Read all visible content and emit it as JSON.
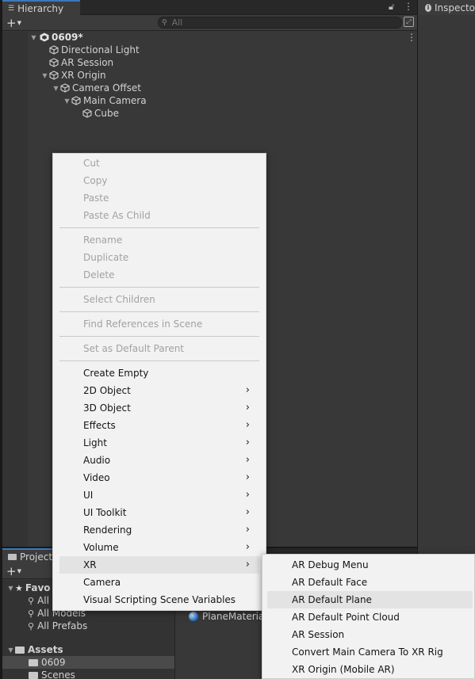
{
  "hierarchy": {
    "tab_label": "Hierarchy",
    "search_placeholder": "All",
    "scene_name": "0609*",
    "items": [
      {
        "label": "Directional Light"
      },
      {
        "label": "AR Session"
      },
      {
        "label": "XR Origin",
        "expanded": true
      },
      {
        "label": "Camera Offset",
        "expanded": true
      },
      {
        "label": "Main Camera",
        "expanded": true
      },
      {
        "label": "Cube"
      }
    ]
  },
  "inspector": {
    "tab_label": "Inspecto"
  },
  "project": {
    "tab_label": "Project",
    "favorites_label": "Favo",
    "favorite_items": [
      "All",
      "All Models",
      "All Prefabs"
    ],
    "assets_label": "Assets",
    "asset_folders": [
      "0609",
      "Scenes"
    ],
    "selected_folder": "0609",
    "content_item": "PlaneMateria"
  },
  "context_menu": {
    "groups": [
      [
        {
          "label": "Cut",
          "enabled": false
        },
        {
          "label": "Copy",
          "enabled": false
        },
        {
          "label": "Paste",
          "enabled": false
        },
        {
          "label": "Paste As Child",
          "enabled": false
        }
      ],
      [
        {
          "label": "Rename",
          "enabled": false
        },
        {
          "label": "Duplicate",
          "enabled": false
        },
        {
          "label": "Delete",
          "enabled": false
        }
      ],
      [
        {
          "label": "Select Children",
          "enabled": false
        }
      ],
      [
        {
          "label": "Find References in Scene",
          "enabled": false
        }
      ],
      [
        {
          "label": "Set as Default Parent",
          "enabled": false
        }
      ],
      [
        {
          "label": "Create Empty",
          "enabled": true
        },
        {
          "label": "2D Object",
          "enabled": true,
          "submenu": true
        },
        {
          "label": "3D Object",
          "enabled": true,
          "submenu": true
        },
        {
          "label": "Effects",
          "enabled": true,
          "submenu": true
        },
        {
          "label": "Light",
          "enabled": true,
          "submenu": true
        },
        {
          "label": "Audio",
          "enabled": true,
          "submenu": true
        },
        {
          "label": "Video",
          "enabled": true,
          "submenu": true
        },
        {
          "label": "UI",
          "enabled": true,
          "submenu": true
        },
        {
          "label": "UI Toolkit",
          "enabled": true,
          "submenu": true
        },
        {
          "label": "Rendering",
          "enabled": true,
          "submenu": true
        },
        {
          "label": "Volume",
          "enabled": true,
          "submenu": true
        },
        {
          "label": "XR",
          "enabled": true,
          "submenu": true,
          "highlighted": true
        },
        {
          "label": "Camera",
          "enabled": true
        },
        {
          "label": "Visual Scripting Scene Variables",
          "enabled": true
        }
      ]
    ]
  },
  "xr_submenu": {
    "items": [
      {
        "label": "AR Debug Menu"
      },
      {
        "label": "AR Default Face"
      },
      {
        "label": "AR Default Plane",
        "highlighted": true
      },
      {
        "label": "AR Default Point Cloud"
      },
      {
        "label": "AR Session"
      },
      {
        "label": "Convert Main Camera To XR Rig"
      },
      {
        "label": "XR Origin (Mobile AR)"
      }
    ]
  },
  "icons": {
    "menu_arrow": "chevron-right-icon",
    "object": "cube-icon",
    "scene": "unity-scene-icon"
  }
}
